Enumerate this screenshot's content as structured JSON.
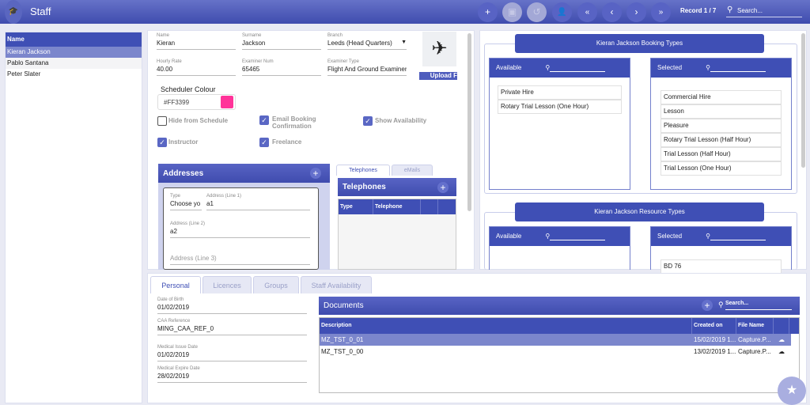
{
  "header": {
    "title": "Staff",
    "record": "Record 1 / 7",
    "search_placeholder": "Search..."
  },
  "toolbar": [
    "add-icon",
    "save-icon",
    "undo-icon",
    "user-settings-icon",
    "first-icon",
    "previous-icon",
    "next-icon",
    "last-icon"
  ],
  "staff_list": {
    "header": "Name",
    "items": [
      "Kieran Jackson",
      "Pablo Santana",
      "Peter Slater"
    ],
    "selected": 0
  },
  "form": {
    "name": {
      "label": "Name",
      "value": "Kieran"
    },
    "surname": {
      "label": "Surname",
      "value": "Jackson"
    },
    "branch": {
      "label": "Branch",
      "value": "Leeds (Head Quarters)"
    },
    "hourly_rate": {
      "label": "Hourly Rate",
      "value": "40.00"
    },
    "examiner_num": {
      "label": "Examiner Num",
      "value": "65465"
    },
    "examiner_type": {
      "label": "Examiner Type",
      "value": "Flight And Ground Examiner"
    },
    "upload_label": "Upload F",
    "scheduler_colour_label": "Scheduler Colour",
    "scheduler_colour": "#FF3399",
    "checkboxes": [
      {
        "label": "Hide from Schedule",
        "checked": false
      },
      {
        "label": "Email Booking Confirmation",
        "checked": true
      },
      {
        "label": "Show Availability",
        "checked": true
      },
      {
        "label": "Instructor",
        "checked": true
      },
      {
        "label": "Freelance",
        "checked": true
      }
    ]
  },
  "addresses": {
    "title": "Addresses",
    "type_label": "Type",
    "type_value": "Choose yo",
    "line1_label": "Address (Line 1)",
    "line1_value": "a1",
    "line2_label": "Address (Line 2)",
    "line2_value": "a2",
    "line3_placeholder": "Address (Line 3)"
  },
  "contacts": {
    "tabs": [
      "Telephones",
      "eMails"
    ],
    "title": "Telephones",
    "columns": [
      "Type",
      "Telephone"
    ]
  },
  "booking_types": {
    "title": "Kieran Jackson Booking Types",
    "available_label": "Available",
    "selected_label": "Selected",
    "available": [
      "Private Hire",
      "Rotary Trial Lesson (One Hour)"
    ],
    "selected": [
      "Commercial Hire",
      "Lesson",
      "Pleasure",
      "Rotary Trial Lesson (Half Hour)",
      "Trial Lesson (Half Hour)",
      "Trial Lesson (One Hour)"
    ]
  },
  "resource_types": {
    "title": "Kieran Jackson Resource Types",
    "available_label": "Available",
    "selected_label": "Selected",
    "selected": [
      "BD 76"
    ]
  },
  "bottom_tabs": [
    "Personal",
    "Licences",
    "Groups",
    "Staff Availability"
  ],
  "personal": [
    {
      "label": "Date of Birth",
      "value": "01/02/2019"
    },
    {
      "label": "CAA Reference",
      "value": "MING_CAA_REF_0"
    },
    {
      "label": "Medical Issue Date",
      "value": "01/02/2019"
    },
    {
      "label": "Medical Expire Date",
      "value": "28/02/2019"
    }
  ],
  "documents": {
    "title": "Documents",
    "search_placeholder": "Search...",
    "columns": [
      "Description",
      "Created on",
      "File Name"
    ],
    "rows": [
      [
        "MZ_TST_0_01",
        "15/02/2019 1...",
        "Capture.P..."
      ],
      [
        "MZ_TST_0_00",
        "13/02/2019 1...",
        "Capture.P..."
      ]
    ]
  },
  "colors": {
    "accent": "#3f4fb5",
    "selected_row": "#7b86cc",
    "scheduler": "#FF3399"
  }
}
